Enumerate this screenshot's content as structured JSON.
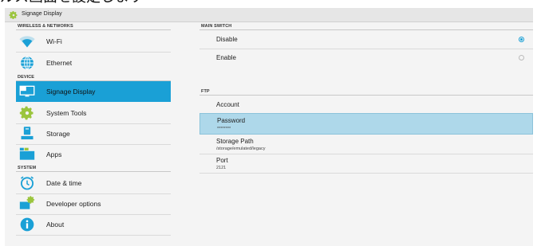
{
  "caption": "ルス画面を設定します",
  "window": {
    "title": "Signage Display",
    "icon": "gear-icon"
  },
  "sidebar": {
    "sections": [
      {
        "title": "WIRELESS & NETWORKS"
      },
      {
        "title": "DEVICE"
      },
      {
        "title": "SYSTEM"
      }
    ],
    "items": [
      {
        "label": "Wi-Fi",
        "icon": "wifi-icon"
      },
      {
        "label": "Ethernet",
        "icon": "globe-icon"
      },
      {
        "label": "Signage Display",
        "icon": "display-icon",
        "selected": true
      },
      {
        "label": "System Tools",
        "icon": "gear-icon"
      },
      {
        "label": "Storage",
        "icon": "storage-icon"
      },
      {
        "label": "Apps",
        "icon": "apps-icon"
      },
      {
        "label": "Date & time",
        "icon": "clock-icon"
      },
      {
        "label": "Developer options",
        "icon": "developer-icon"
      },
      {
        "label": "About",
        "icon": "info-icon"
      }
    ]
  },
  "main_switch": {
    "title": "MAIN SWITCH",
    "options": [
      {
        "label": "Disable",
        "checked": true
      },
      {
        "label": "Enable",
        "checked": false
      }
    ]
  },
  "ftp": {
    "title": "FTP",
    "rows": [
      {
        "label": "Account",
        "value": ""
      },
      {
        "label": "Password",
        "value": "********",
        "selected": true
      },
      {
        "label": "Storage Path",
        "value": "/storage/emulated/legacy"
      },
      {
        "label": "Port",
        "value": "2121"
      }
    ]
  },
  "colors": {
    "accent": "#1aa0d6",
    "selected_row": "#aed8ea",
    "background": "#f4f4f4"
  }
}
